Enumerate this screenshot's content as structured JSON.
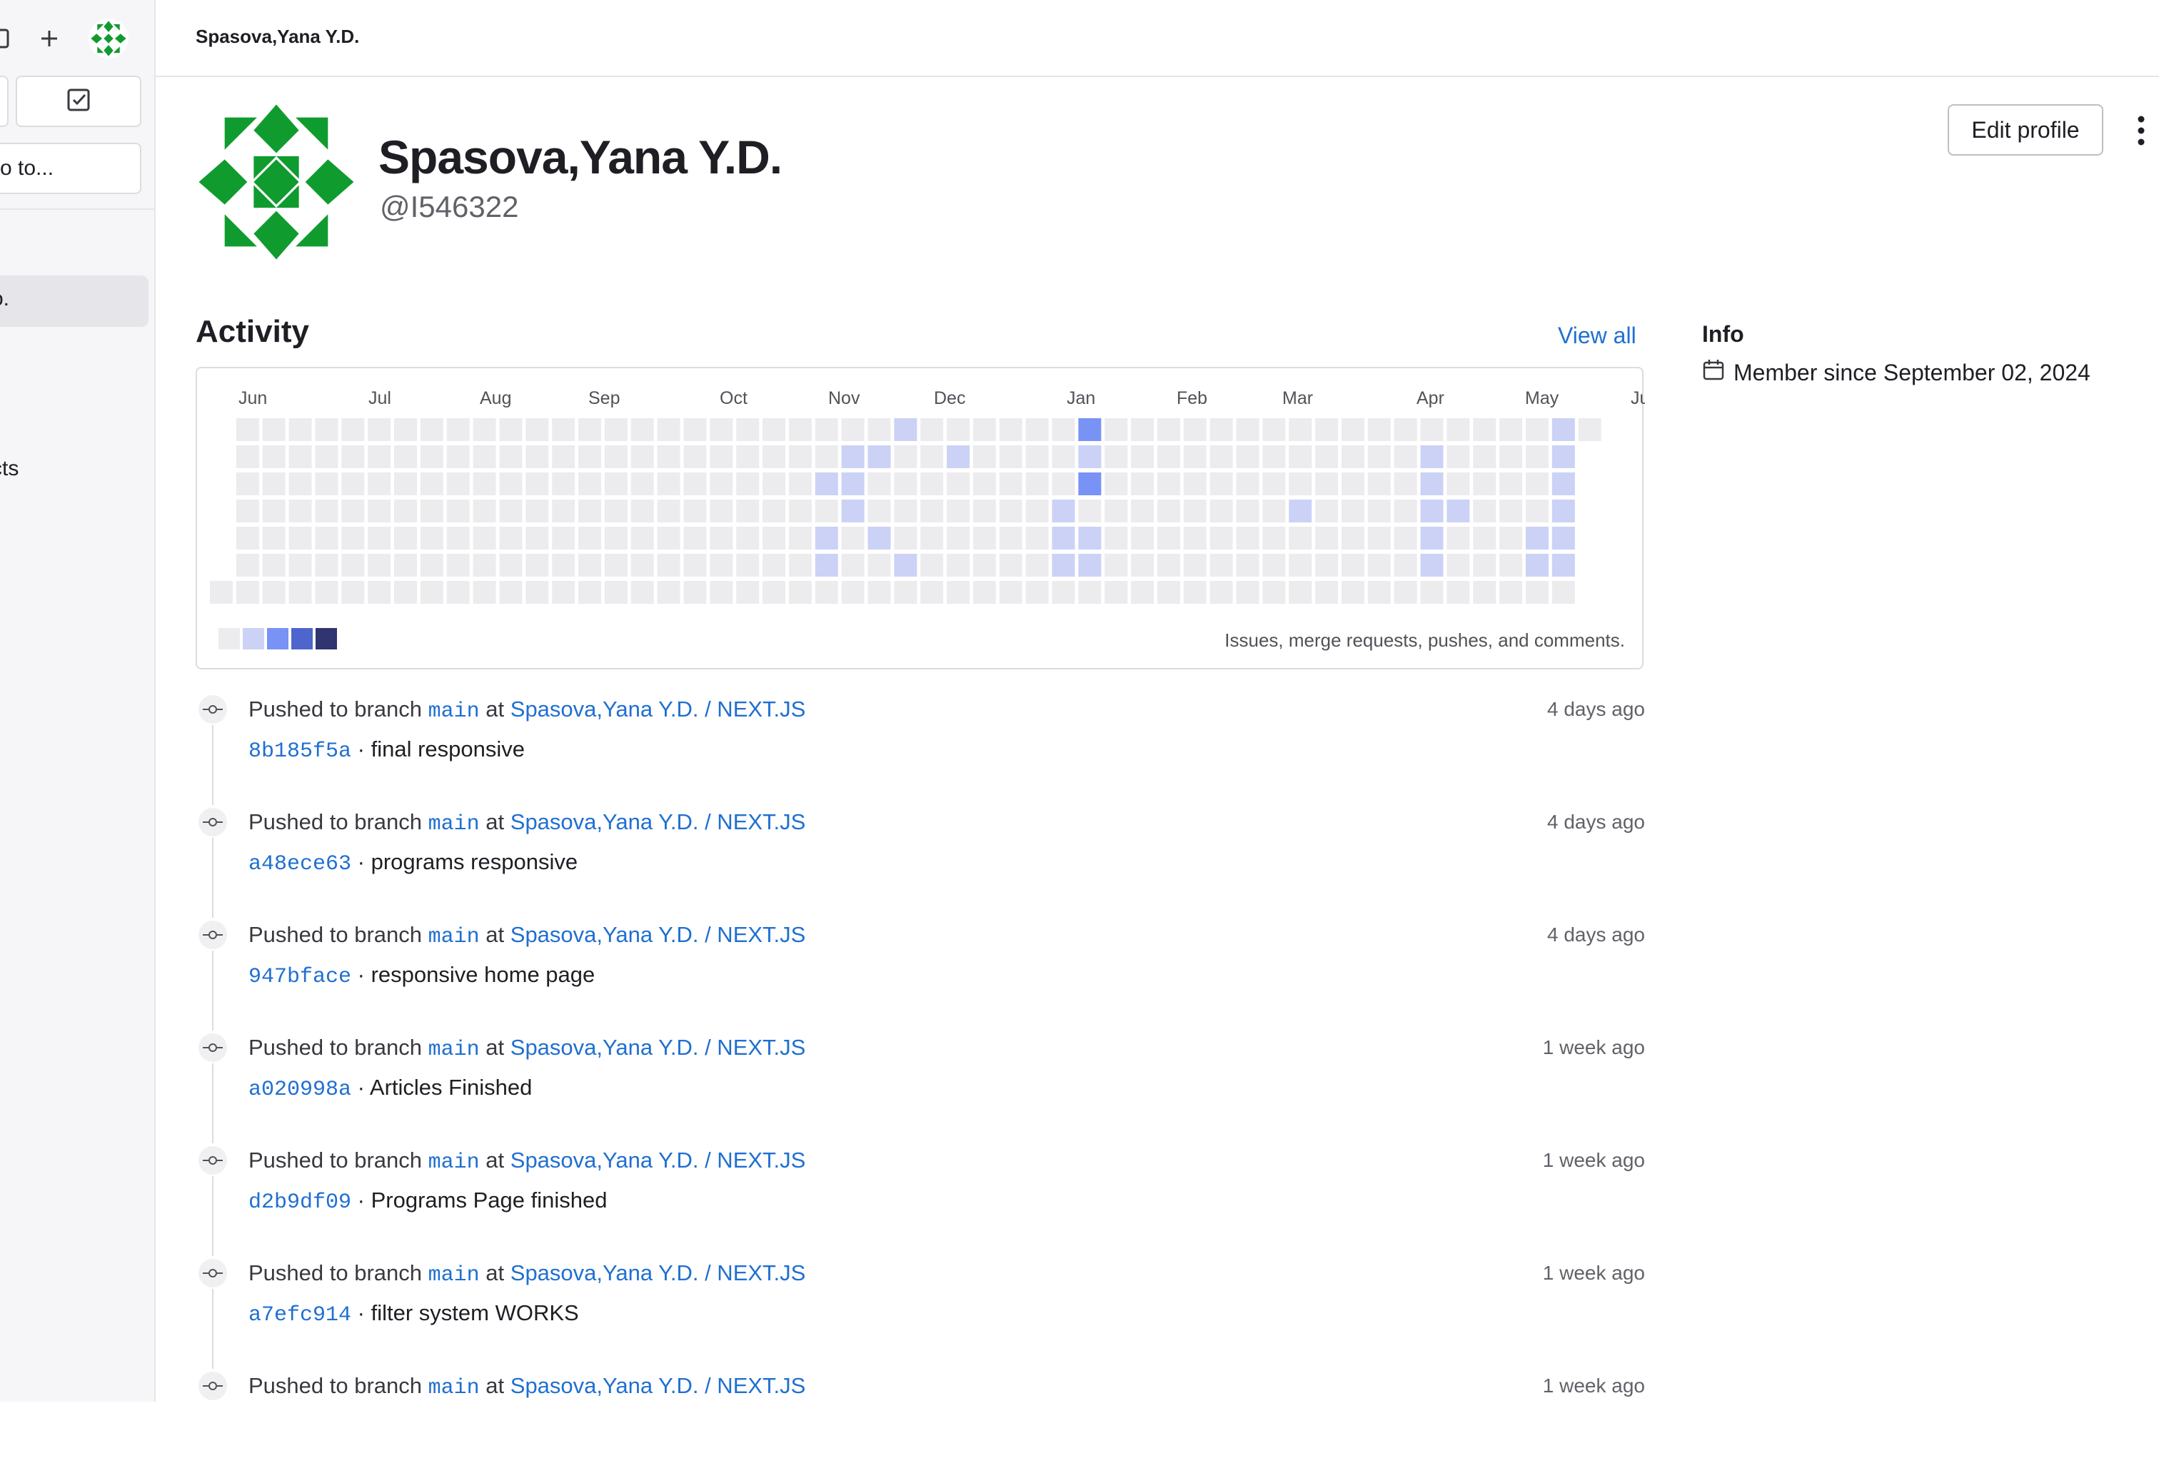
{
  "sidebar": {
    "goto_label": "o to...",
    "items": [
      {
        "label": "o."
      },
      {
        "label": "cts"
      }
    ]
  },
  "header": {
    "breadcrumb": "Spasova,Yana Y.D."
  },
  "profile": {
    "name": "Spasova,Yana Y.D.",
    "handle": "@I546322",
    "edit_label": "Edit profile"
  },
  "activity": {
    "title": "Activity",
    "view_all": "View all",
    "caption": "Issues, merge requests, pushes, and comments."
  },
  "info": {
    "title": "Info",
    "member_since": "Member since September 02, 2024"
  },
  "colors": {
    "accent": "#1f6fd1",
    "level0": "#ececef",
    "level1": "#cbd2f6",
    "level2": "#7992f5",
    "level3": "#4e65cd",
    "level4": "#303470",
    "avatar": "#109b2f"
  },
  "chart_data": {
    "type": "heatmap",
    "months": [
      "Jun",
      "Jul",
      "Aug",
      "Sep",
      "Oct",
      "Nov",
      "Dec",
      "Jan",
      "Feb",
      "Mar",
      "Apr",
      "May",
      "Jun"
    ],
    "active_cells": [
      {
        "week": 26,
        "day": 0,
        "level": 1
      },
      {
        "week": 25,
        "day": 1,
        "level": 1
      },
      {
        "week": 24,
        "day": 1,
        "level": 1
      },
      {
        "week": 24,
        "day": 2,
        "level": 1
      },
      {
        "week": 23,
        "day": 2,
        "level": 1
      },
      {
        "week": 24,
        "day": 3,
        "level": 1
      },
      {
        "week": 23,
        "day": 4,
        "level": 1
      },
      {
        "week": 25,
        "day": 4,
        "level": 1
      },
      {
        "week": 23,
        "day": 5,
        "level": 1
      },
      {
        "week": 26,
        "day": 5,
        "level": 1
      },
      {
        "week": 28,
        "day": 1,
        "level": 1
      },
      {
        "week": 33,
        "day": 0,
        "level": 2
      },
      {
        "week": 33,
        "day": 1,
        "level": 1
      },
      {
        "week": 33,
        "day": 2,
        "level": 2
      },
      {
        "week": 32,
        "day": 3,
        "level": 1
      },
      {
        "week": 32,
        "day": 4,
        "level": 1
      },
      {
        "week": 33,
        "day": 4,
        "level": 1
      },
      {
        "week": 32,
        "day": 5,
        "level": 1
      },
      {
        "week": 33,
        "day": 5,
        "level": 1
      },
      {
        "week": 41,
        "day": 3,
        "level": 1
      },
      {
        "week": 46,
        "day": 1,
        "level": 1
      },
      {
        "week": 46,
        "day": 2,
        "level": 1
      },
      {
        "week": 46,
        "day": 3,
        "level": 1
      },
      {
        "week": 47,
        "day": 3,
        "level": 1
      },
      {
        "week": 46,
        "day": 4,
        "level": 1
      },
      {
        "week": 46,
        "day": 5,
        "level": 1
      },
      {
        "week": 51,
        "day": 0,
        "level": 1
      },
      {
        "week": 51,
        "day": 1,
        "level": 1
      },
      {
        "week": 51,
        "day": 2,
        "level": 1
      },
      {
        "week": 51,
        "day": 3,
        "level": 1
      },
      {
        "week": 52,
        "day": 3,
        "level": 1
      },
      {
        "week": 50,
        "day": 4,
        "level": 1
      },
      {
        "week": 51,
        "day": 4,
        "level": 1
      },
      {
        "week": 50,
        "day": 5,
        "level": 1
      },
      {
        "week": 51,
        "day": 5,
        "level": 1
      }
    ],
    "legend_levels": [
      0,
      1,
      2,
      3,
      4
    ],
    "caption": "Issues, merge requests, pushes, and comments."
  },
  "events": [
    {
      "action": "Pushed to branch",
      "branch": "main",
      "at": "at",
      "project": "Spasova,Yana Y.D. / NEXT.JS",
      "sha": "8b185f5a",
      "sep": "·",
      "message": "final responsive",
      "time": "4 days ago"
    },
    {
      "action": "Pushed to branch",
      "branch": "main",
      "at": "at",
      "project": "Spasova,Yana Y.D. / NEXT.JS",
      "sha": "a48ece63",
      "sep": "·",
      "message": "programs responsive",
      "time": "4 days ago"
    },
    {
      "action": "Pushed to branch",
      "branch": "main",
      "at": "at",
      "project": "Spasova,Yana Y.D. / NEXT.JS",
      "sha": "947bface",
      "sep": "·",
      "message": "responsive home page",
      "time": "4 days ago"
    },
    {
      "action": "Pushed to branch",
      "branch": "main",
      "at": "at",
      "project": "Spasova,Yana Y.D. / NEXT.JS",
      "sha": "a020998a",
      "sep": "·",
      "message": "Articles Finished",
      "time": "1 week ago"
    },
    {
      "action": "Pushed to branch",
      "branch": "main",
      "at": "at",
      "project": "Spasova,Yana Y.D. / NEXT.JS",
      "sha": "d2b9df09",
      "sep": "·",
      "message": "Programs Page finished",
      "time": "1 week ago"
    },
    {
      "action": "Pushed to branch",
      "branch": "main",
      "at": "at",
      "project": "Spasova,Yana Y.D. / NEXT.JS",
      "sha": "a7efc914",
      "sep": "·",
      "message": "filter system WORKS",
      "time": "1 week ago"
    },
    {
      "action": "Pushed to branch",
      "branch": "main",
      "at": "at",
      "project": "Spasova,Yana Y.D. / NEXT.JS",
      "sha": "",
      "sep": "",
      "message": "",
      "time": "1 week ago"
    }
  ]
}
